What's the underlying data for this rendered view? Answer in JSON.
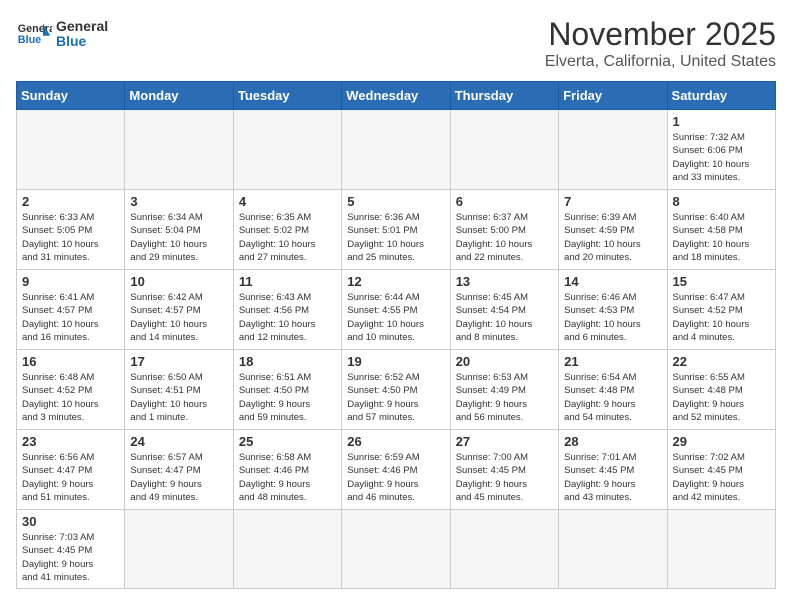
{
  "logo": {
    "text_general": "General",
    "text_blue": "Blue"
  },
  "header": {
    "month": "November 2025",
    "location": "Elverta, California, United States"
  },
  "weekdays": [
    "Sunday",
    "Monday",
    "Tuesday",
    "Wednesday",
    "Thursday",
    "Friday",
    "Saturday"
  ],
  "weeks": [
    [
      {
        "day": "",
        "info": ""
      },
      {
        "day": "",
        "info": ""
      },
      {
        "day": "",
        "info": ""
      },
      {
        "day": "",
        "info": ""
      },
      {
        "day": "",
        "info": ""
      },
      {
        "day": "",
        "info": ""
      },
      {
        "day": "1",
        "info": "Sunrise: 7:32 AM\nSunset: 6:06 PM\nDaylight: 10 hours\nand 33 minutes."
      }
    ],
    [
      {
        "day": "2",
        "info": "Sunrise: 6:33 AM\nSunset: 5:05 PM\nDaylight: 10 hours\nand 31 minutes."
      },
      {
        "day": "3",
        "info": "Sunrise: 6:34 AM\nSunset: 5:04 PM\nDaylight: 10 hours\nand 29 minutes."
      },
      {
        "day": "4",
        "info": "Sunrise: 6:35 AM\nSunset: 5:02 PM\nDaylight: 10 hours\nand 27 minutes."
      },
      {
        "day": "5",
        "info": "Sunrise: 6:36 AM\nSunset: 5:01 PM\nDaylight: 10 hours\nand 25 minutes."
      },
      {
        "day": "6",
        "info": "Sunrise: 6:37 AM\nSunset: 5:00 PM\nDaylight: 10 hours\nand 22 minutes."
      },
      {
        "day": "7",
        "info": "Sunrise: 6:39 AM\nSunset: 4:59 PM\nDaylight: 10 hours\nand 20 minutes."
      },
      {
        "day": "8",
        "info": "Sunrise: 6:40 AM\nSunset: 4:58 PM\nDaylight: 10 hours\nand 18 minutes."
      }
    ],
    [
      {
        "day": "9",
        "info": "Sunrise: 6:41 AM\nSunset: 4:57 PM\nDaylight: 10 hours\nand 16 minutes."
      },
      {
        "day": "10",
        "info": "Sunrise: 6:42 AM\nSunset: 4:57 PM\nDaylight: 10 hours\nand 14 minutes."
      },
      {
        "day": "11",
        "info": "Sunrise: 6:43 AM\nSunset: 4:56 PM\nDaylight: 10 hours\nand 12 minutes."
      },
      {
        "day": "12",
        "info": "Sunrise: 6:44 AM\nSunset: 4:55 PM\nDaylight: 10 hours\nand 10 minutes."
      },
      {
        "day": "13",
        "info": "Sunrise: 6:45 AM\nSunset: 4:54 PM\nDaylight: 10 hours\nand 8 minutes."
      },
      {
        "day": "14",
        "info": "Sunrise: 6:46 AM\nSunset: 4:53 PM\nDaylight: 10 hours\nand 6 minutes."
      },
      {
        "day": "15",
        "info": "Sunrise: 6:47 AM\nSunset: 4:52 PM\nDaylight: 10 hours\nand 4 minutes."
      }
    ],
    [
      {
        "day": "16",
        "info": "Sunrise: 6:48 AM\nSunset: 4:52 PM\nDaylight: 10 hours\nand 3 minutes."
      },
      {
        "day": "17",
        "info": "Sunrise: 6:50 AM\nSunset: 4:51 PM\nDaylight: 10 hours\nand 1 minute."
      },
      {
        "day": "18",
        "info": "Sunrise: 6:51 AM\nSunset: 4:50 PM\nDaylight: 9 hours\nand 59 minutes."
      },
      {
        "day": "19",
        "info": "Sunrise: 6:52 AM\nSunset: 4:50 PM\nDaylight: 9 hours\nand 57 minutes."
      },
      {
        "day": "20",
        "info": "Sunrise: 6:53 AM\nSunset: 4:49 PM\nDaylight: 9 hours\nand 56 minutes."
      },
      {
        "day": "21",
        "info": "Sunrise: 6:54 AM\nSunset: 4:48 PM\nDaylight: 9 hours\nand 54 minutes."
      },
      {
        "day": "22",
        "info": "Sunrise: 6:55 AM\nSunset: 4:48 PM\nDaylight: 9 hours\nand 52 minutes."
      }
    ],
    [
      {
        "day": "23",
        "info": "Sunrise: 6:56 AM\nSunset: 4:47 PM\nDaylight: 9 hours\nand 51 minutes."
      },
      {
        "day": "24",
        "info": "Sunrise: 6:57 AM\nSunset: 4:47 PM\nDaylight: 9 hours\nand 49 minutes."
      },
      {
        "day": "25",
        "info": "Sunrise: 6:58 AM\nSunset: 4:46 PM\nDaylight: 9 hours\nand 48 minutes."
      },
      {
        "day": "26",
        "info": "Sunrise: 6:59 AM\nSunset: 4:46 PM\nDaylight: 9 hours\nand 46 minutes."
      },
      {
        "day": "27",
        "info": "Sunrise: 7:00 AM\nSunset: 4:45 PM\nDaylight: 9 hours\nand 45 minutes."
      },
      {
        "day": "28",
        "info": "Sunrise: 7:01 AM\nSunset: 4:45 PM\nDaylight: 9 hours\nand 43 minutes."
      },
      {
        "day": "29",
        "info": "Sunrise: 7:02 AM\nSunset: 4:45 PM\nDaylight: 9 hours\nand 42 minutes."
      }
    ],
    [
      {
        "day": "30",
        "info": "Sunrise: 7:03 AM\nSunset: 4:45 PM\nDaylight: 9 hours\nand 41 minutes."
      },
      {
        "day": "",
        "info": ""
      },
      {
        "day": "",
        "info": ""
      },
      {
        "day": "",
        "info": ""
      },
      {
        "day": "",
        "info": ""
      },
      {
        "day": "",
        "info": ""
      },
      {
        "day": "",
        "info": ""
      }
    ]
  ]
}
